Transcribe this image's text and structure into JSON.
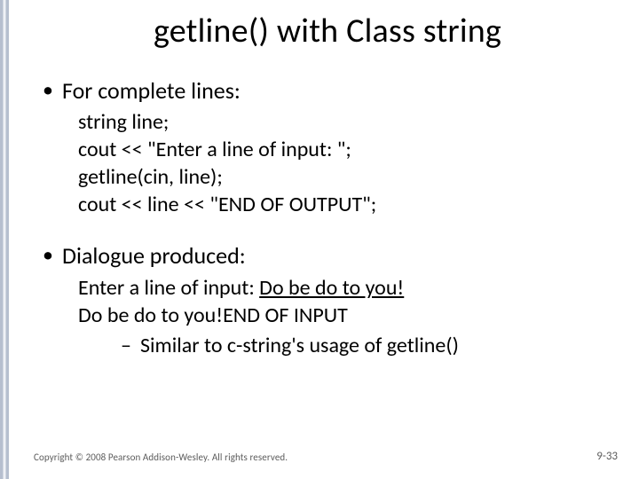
{
  "title": "getline() with Class string",
  "bullets": {
    "b1": "For complete lines:",
    "code": {
      "l1": "string line;",
      "l2": "cout << \"Enter a line of input: \";",
      "l3": "getline(cin, line);",
      "l4": "cout << line << \"END OF OUTPUT\";"
    },
    "b2": "Dialogue produced:",
    "dialogue": {
      "d1a": "Enter a line of input: ",
      "d1b": "Do be do to you!",
      "d2": "Do be do to you!END OF INPUT",
      "d3": "Similar to c-string's usage of getline()"
    }
  },
  "footer": "Copyright © 2008 Pearson Addison-Wesley. All rights reserved.",
  "pagenum": "9-33"
}
